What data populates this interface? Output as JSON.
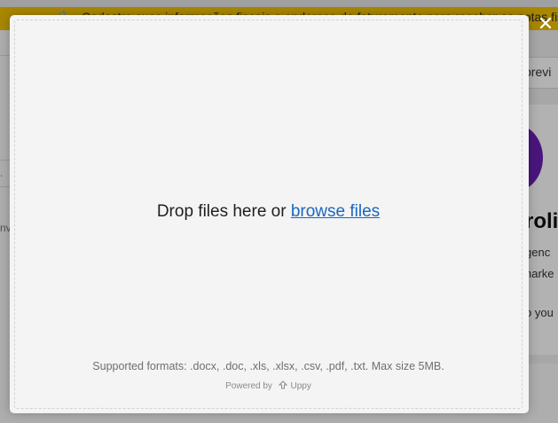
{
  "background": {
    "banner_text": "Cadastre suas informações fiscais e endereço de faturamento para receber as notas fiscais",
    "tab_label": "previ",
    "heading": "roli",
    "lines": [
      "genc",
      "narke",
      "o you"
    ],
    "sidebar_fragments": [
      ".",
      "nv"
    ]
  },
  "modal": {
    "drop_prefix": "Drop files here or",
    "browse_label": "browse files",
    "formats": "Supported formats: .docx, .doc, .xls, .xlsx, .csv, .pdf, .txt. Max size 5MB.",
    "powered_by": "Powered by",
    "brand": "Uppy",
    "close_symbol": "✕"
  },
  "colors": {
    "banner": "#f2c200",
    "link": "#1a66c2",
    "avatar": "#6a1fb4"
  }
}
